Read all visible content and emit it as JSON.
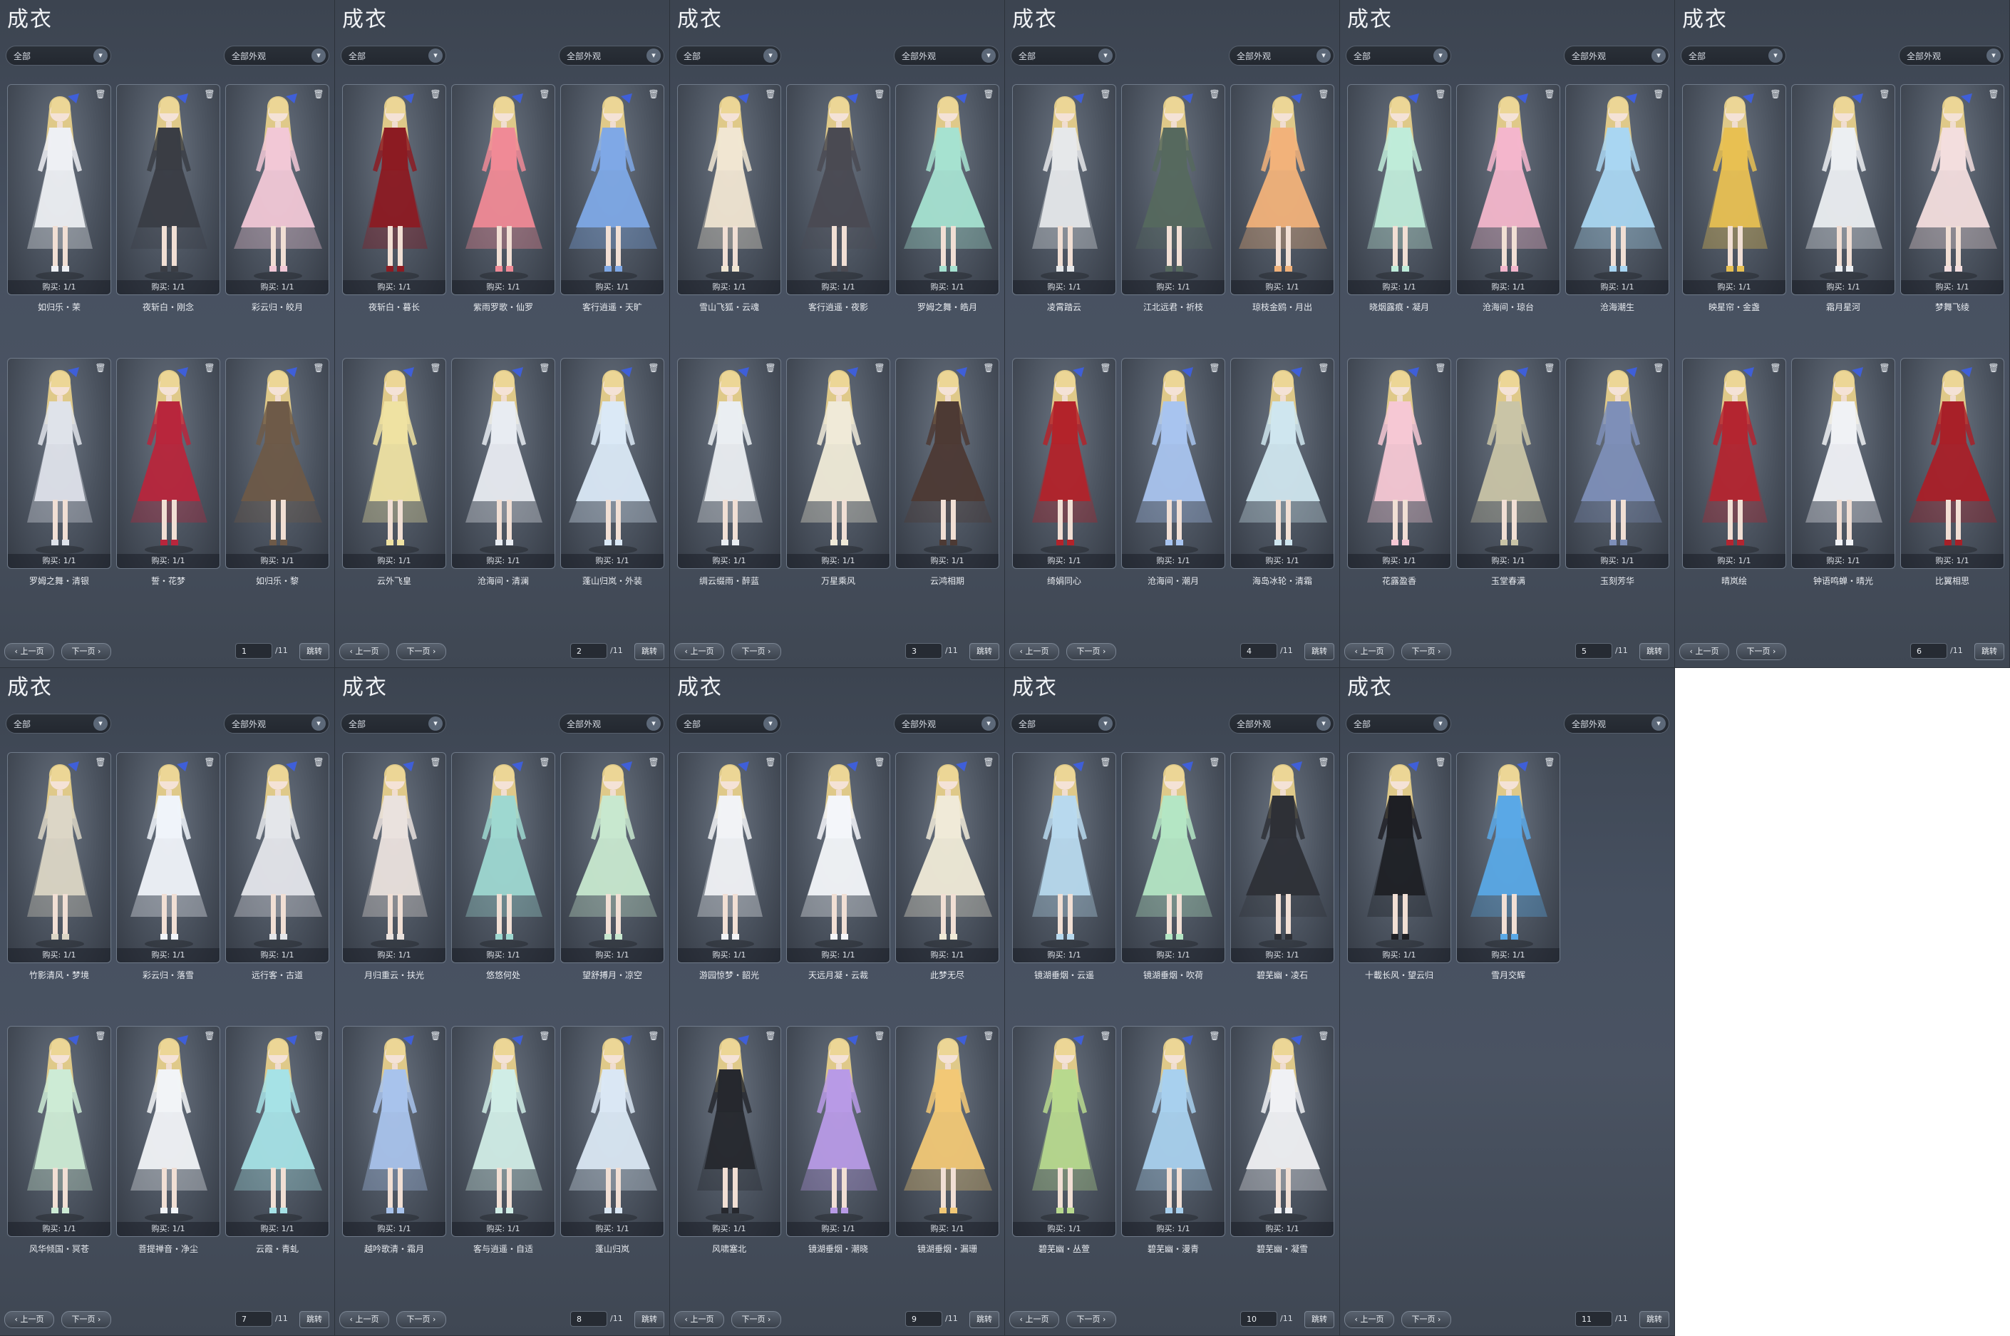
{
  "title": "成衣",
  "filters": {
    "type_selected": "全部",
    "look_selected": "全部外观"
  },
  "pager": {
    "prev_label": "上一页",
    "next_label": "下一页",
    "jump_label": "跳转",
    "total_pages": "11"
  },
  "pages": [
    {
      "page": "1",
      "items": [
        {
          "name": "如归乐・茉",
          "buy": "购买: 1/1"
        },
        {
          "name": "夜斩白・刚念",
          "buy": "购买: 1/1"
        },
        {
          "name": "彩云归・皎月",
          "buy": "购买: 1/1"
        },
        {
          "name": "罗姆之舞・清银",
          "buy": "购买: 1/1"
        },
        {
          "name": "誓・花梦",
          "buy": "购买: 1/1"
        },
        {
          "name": "如归乐・黎",
          "buy": "购买: 1/1"
        }
      ]
    },
    {
      "page": "2",
      "items": [
        {
          "name": "夜斩白・暮长",
          "buy": "购买: 1/1"
        },
        {
          "name": "紫雨罗歌・仙罗",
          "buy": "购买: 1/1"
        },
        {
          "name": "客行逍遥・天旷",
          "buy": "购买: 1/1"
        },
        {
          "name": "云外飞皇",
          "buy": "购买: 1/1"
        },
        {
          "name": "沧海间・清澜",
          "buy": "购买: 1/1"
        },
        {
          "name": "蓬山归岚・外装",
          "buy": "购买: 1/1"
        }
      ]
    },
    {
      "page": "3",
      "items": [
        {
          "name": "雪山飞狐・云魂",
          "buy": "购买: 1/1"
        },
        {
          "name": "客行逍遥・夜影",
          "buy": "购买: 1/1"
        },
        {
          "name": "罗姆之舞・皓月",
          "buy": "购买: 1/1"
        },
        {
          "name": "绸云缀雨・醉蓝",
          "buy": "购买: 1/1"
        },
        {
          "name": "万星乘风",
          "buy": "购买: 1/1"
        },
        {
          "name": "云鸿相期",
          "buy": "购买: 1/1"
        }
      ]
    },
    {
      "page": "4",
      "items": [
        {
          "name": "凌霄踏云",
          "buy": "购买: 1/1"
        },
        {
          "name": "江北远君・祈枝",
          "buy": "购买: 1/1"
        },
        {
          "name": "琼枝金鸥・月出",
          "buy": "购买: 1/1"
        },
        {
          "name": "绮娟同心",
          "buy": "购买: 1/1"
        },
        {
          "name": "沧海间・潮月",
          "buy": "购买: 1/1"
        },
        {
          "name": "海岛冰轮・清霜",
          "buy": "购买: 1/1"
        }
      ]
    },
    {
      "page": "5",
      "items": [
        {
          "name": "晓烟露痕・凝月",
          "buy": "购买: 1/1"
        },
        {
          "name": "沧海间・琼台",
          "buy": "购买: 1/1"
        },
        {
          "name": "沧海潮生",
          "buy": "购买: 1/1"
        },
        {
          "name": "花露盈香",
          "buy": "购买: 1/1"
        },
        {
          "name": "玉堂春满",
          "buy": "购买: 1/1"
        },
        {
          "name": "玉刻芳华",
          "buy": "购买: 1/1"
        }
      ]
    },
    {
      "page": "6",
      "items": [
        {
          "name": "映星帘・金盏",
          "buy": "购买: 1/1"
        },
        {
          "name": "霜月星河",
          "buy": "购买: 1/1"
        },
        {
          "name": "梦舞飞绫",
          "buy": "购买: 1/1"
        },
        {
          "name": "晴岚绘",
          "buy": "购买: 1/1"
        },
        {
          "name": "钟语鸣蝉・晴光",
          "buy": "购买: 1/1"
        },
        {
          "name": "比翼相思",
          "buy": "购买: 1/1"
        }
      ]
    },
    {
      "page": "7",
      "items": [
        {
          "name": "竹影清风・梦境",
          "buy": "购买: 1/1"
        },
        {
          "name": "彩云归・落雪",
          "buy": "购买: 1/1"
        },
        {
          "name": "远行客・古道",
          "buy": "购买: 1/1"
        },
        {
          "name": "风华倾国・冥苍",
          "buy": "购买: 1/1"
        },
        {
          "name": "菩提禅音・净尘",
          "buy": "购买: 1/1"
        },
        {
          "name": "云霞・青虬",
          "buy": "购买: 1/1"
        }
      ]
    },
    {
      "page": "8",
      "items": [
        {
          "name": "月归重云・扶光",
          "buy": "购买: 1/1"
        },
        {
          "name": "悠悠何处",
          "buy": "购买: 1/1"
        },
        {
          "name": "望舒搏月・凉空",
          "buy": "购买: 1/1"
        },
        {
          "name": "越吟歌清・霜月",
          "buy": "购买: 1/1"
        },
        {
          "name": "客与逍遥・自适",
          "buy": "购买: 1/1"
        },
        {
          "name": "蓬山归岚",
          "buy": "购买: 1/1"
        }
      ]
    },
    {
      "page": "9",
      "items": [
        {
          "name": "游园惊梦・韶光",
          "buy": "购买: 1/1"
        },
        {
          "name": "天远月凝・云裁",
          "buy": "购买: 1/1"
        },
        {
          "name": "此梦无尽",
          "buy": "购买: 1/1"
        },
        {
          "name": "风啸塞北",
          "buy": "购买: 1/1"
        },
        {
          "name": "镜湖垂烟・潮晓",
          "buy": "购买: 1/1"
        },
        {
          "name": "镜湖垂烟・漏珊",
          "buy": "购买: 1/1"
        }
      ]
    },
    {
      "page": "10",
      "items": [
        {
          "name": "镜湖垂烟・云遥",
          "buy": "购买: 1/1"
        },
        {
          "name": "镜湖垂烟・吹荷",
          "buy": "购买: 1/1"
        },
        {
          "name": "碧芜幽・凌石",
          "buy": "购买: 1/1"
        },
        {
          "name": "碧芜幽・丛萱",
          "buy": "购买: 1/1"
        },
        {
          "name": "碧芜幽・漫青",
          "buy": "购买: 1/1"
        },
        {
          "name": "碧芜幽・凝雪",
          "buy": "购买: 1/1"
        }
      ]
    },
    {
      "page": "11",
      "items": [
        {
          "name": "十載长风・望云归",
          "buy": "购买: 1/1"
        },
        {
          "name": "雪月交辉",
          "buy": "购买: 1/1"
        }
      ]
    }
  ],
  "icons": {
    "trash": "trash-icon",
    "chevron": "chevron-down-icon",
    "prev": "chevron-left-icon",
    "next": "chevron-right-icon"
  },
  "outfit_colors": [
    [
      "#eef0f4",
      "#3a3d44",
      "#f2c8d6",
      "#dfe3ea",
      "#b8263c",
      "#6e5a48"
    ],
    [
      "#8c1b22",
      "#f08a96",
      "#7fa8e6",
      "#efe2a2",
      "#e8ecf2",
      "#dbe9f6"
    ],
    [
      "#f1e6d2",
      "#4a4a52",
      "#a6e2d0",
      "#eaeef2",
      "#f0ead8",
      "#4d3a34"
    ],
    [
      "#e6e8ea",
      "#56695e",
      "#f2b27a",
      "#b3232a",
      "#a8c4ef",
      "#cfe6ef"
    ],
    [
      "#bfecd9",
      "#f4b6cc",
      "#a9d6f2",
      "#f6c8d4",
      "#c9c4a6",
      "#7e8fb8"
    ],
    [
      "#e8c052",
      "#eceff2",
      "#f3dede",
      "#b42530",
      "#f0f2f5",
      "#a82028"
    ],
    [
      "#dcd6c6",
      "#f0f4fa",
      "#e4e6ea",
      "#cdebd5",
      "#f2f4f7",
      "#a6e2e6"
    ],
    [
      "#eae2de",
      "#9ed8d0",
      "#c8e8cf",
      "#a8c3ec",
      "#d0ede6",
      "#dae7f4"
    ],
    [
      "#f2f3f6",
      "#f4f6fa",
      "#f0ead8",
      "#26282e",
      "#b89ae6",
      "#f2c876"
    ],
    [
      "#b8d9ee",
      "#b4e6c4",
      "#2e3036",
      "#b8d98e",
      "#a8d0ee",
      "#f0f1f4"
    ],
    [
      "#1e1f24",
      "#5aa8e6"
    ]
  ]
}
